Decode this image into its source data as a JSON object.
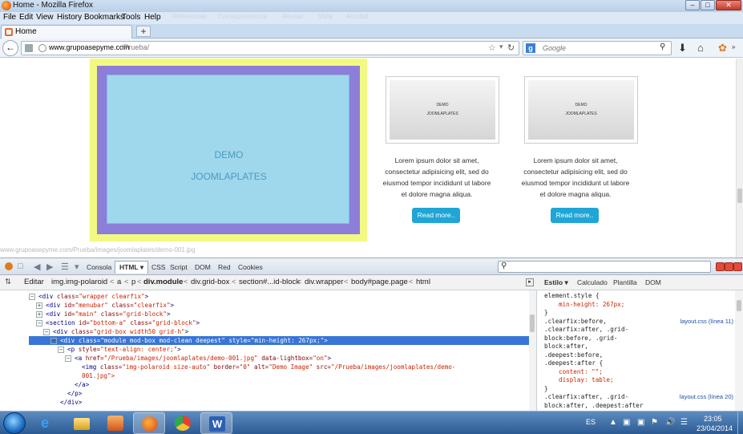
{
  "window": {
    "title": "Home - Mozilla Firefox",
    "controls": [
      "–",
      "□",
      "✕"
    ]
  },
  "menu": {
    "items": [
      "File",
      "Edit",
      "View",
      "History",
      "Bookmarks",
      "Tools",
      "Help"
    ],
    "ghost_items": [
      "Referencias",
      "Correspondencia",
      "Revisar",
      "Vista",
      "Acrobat"
    ]
  },
  "tabs": [
    {
      "label": "Home",
      "active": true
    }
  ],
  "newtab_label": "+",
  "navbar": {
    "url_host": "www.grupoasepyme.com",
    "url_path": "/Prueba/",
    "search_engine": "Google",
    "search_placeholder": "Google"
  },
  "page": {
    "hero": {
      "line1": "DEMO",
      "line2": "JOOMLAPLATES"
    },
    "cards": [
      {
        "img_line1": "DEMO",
        "img_line2": "JOOMLAPLATES",
        "text": "Lorem ipsum dolor sit amet, consectetur adipisicing elit, sed do eiusmod tempor incididunt ut labore et dolore magna aliqua.",
        "button": "Read more.."
      },
      {
        "img_line1": "DEMO",
        "img_line2": "JOOMLAPLATES",
        "text": "Lorem ipsum dolor sit amet, consectetur adipisicing elit, sed do eiusmod tempor incididunt ut labore et dolore magna aliqua.",
        "button": "Read more.."
      }
    ],
    "status_url": "www.grupoasepyme.com/Prueba/images/joomlaplates/demo-001.jpg"
  },
  "firebug": {
    "tabs": [
      "Consola",
      "HTML",
      "CSS",
      "Script",
      "DOM",
      "Red",
      "Cookies"
    ],
    "active_tab": "HTML",
    "edit_label": "Editar",
    "breadcrumbs": [
      "img.img-polaroid",
      "a",
      "p",
      "div.module",
      "div.grid-box",
      "section#...id-block",
      "div.wrapper",
      "body#page.page",
      "html"
    ],
    "breadcrumb_selected": "div.module",
    "side_tabs": [
      "Estilo",
      "Calculado",
      "Plantilla",
      "DOM"
    ],
    "side_active": "Estilo",
    "html_tree": [
      {
        "indent": 0,
        "tw": "⊟",
        "tag": "div",
        "attrs": [
          [
            "class",
            "wrapper clearfix"
          ]
        ],
        "close": ">"
      },
      {
        "indent": 1,
        "tw": "⊞",
        "tag": "div",
        "attrs": [
          [
            "id",
            "menubar"
          ],
          [
            "class",
            "clearfix"
          ]
        ],
        "close": ">"
      },
      {
        "indent": 1,
        "tw": "⊞",
        "tag": "div",
        "attrs": [
          [
            "id",
            "main"
          ],
          [
            "class",
            "grid-block"
          ]
        ],
        "close": ">"
      },
      {
        "indent": 1,
        "tw": "⊟",
        "tag": "section",
        "attrs": [
          [
            "id",
            "bottom-a"
          ],
          [
            "class",
            "grid-block"
          ]
        ],
        "close": ">"
      },
      {
        "indent": 2,
        "tw": "⊟",
        "tag": "div",
        "attrs": [
          [
            "class",
            "grid-box width50 grid-h"
          ]
        ],
        "close": ">"
      },
      {
        "indent": 3,
        "tw": "⊟",
        "tag": "div",
        "attrs": [
          [
            "class",
            "module mod-box mod-clean deepest"
          ],
          [
            "style",
            "min-height: 267px;"
          ]
        ],
        "close": ">",
        "selected": true
      },
      {
        "indent": 4,
        "tw": "⊟",
        "tag": "p",
        "attrs": [
          [
            "style",
            "text-align: center;"
          ]
        ],
        "close": ">"
      },
      {
        "indent": 5,
        "tw": "⊟",
        "tag": "a",
        "attrs": [
          [
            "href",
            "/Prueba/images/joomlaplates/demo-001.jpg"
          ],
          [
            "data-lightbox",
            "on"
          ]
        ],
        "close": ">"
      },
      {
        "indent": 6,
        "tw": "",
        "tag": "img",
        "attrs": [
          [
            "class",
            "img-polaroid size-auto"
          ],
          [
            "border",
            "0"
          ],
          [
            "alt",
            "Demo Image"
          ],
          [
            "src",
            "/Prueba/images/joomlaplates/demo-"
          ]
        ],
        "close": ""
      },
      {
        "indent": 6,
        "tw": "",
        "text": "001.jpg\">",
        "raw": true
      },
      {
        "indent": 5,
        "tw": "",
        "tag": "/a",
        "attrs": [],
        "close": ">"
      },
      {
        "indent": 4,
        "tw": "",
        "tag": "/p",
        "attrs": [],
        "close": ">"
      },
      {
        "indent": 3,
        "tw": "",
        "tag": "/div",
        "attrs": [],
        "close": ">"
      }
    ],
    "css_rules": [
      {
        "text": "element.style {",
        "type": "sel"
      },
      {
        "text": "min-height: 267px;",
        "type": "prop"
      },
      {
        "text": "}",
        "type": "sel"
      },
      {
        "text": ".clearfix:before,",
        "type": "sel",
        "link": "layout.css (línea 11)"
      },
      {
        "text": ".clearfix:after, .grid-",
        "type": "sel"
      },
      {
        "text": "block:before, .grid-",
        "type": "sel"
      },
      {
        "text": "block:after,",
        "type": "sel"
      },
      {
        "text": ".deepest:before,",
        "type": "sel"
      },
      {
        "text": ".deepest:after {",
        "type": "sel"
      },
      {
        "text": "content: \"\";",
        "type": "prop"
      },
      {
        "text": "display: table;",
        "type": "prop"
      },
      {
        "text": "}",
        "type": "sel"
      },
      {
        "text": ".clearfix:after, .grid-",
        "type": "sel",
        "link": "layout.css (línea 20)"
      },
      {
        "text": "block:after, .deepest:after",
        "type": "sel"
      }
    ]
  },
  "taskbar": {
    "lang": "ES",
    "time": "23:05",
    "date": "23/04/2014"
  }
}
